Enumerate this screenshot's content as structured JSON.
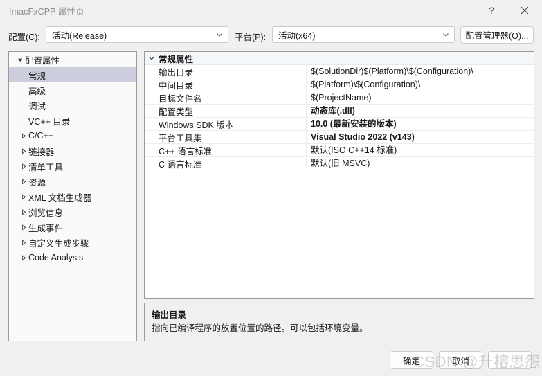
{
  "window": {
    "title": "ImacFxCPP 属性页",
    "help_icon": "question-mark-icon",
    "close_icon": "close-icon"
  },
  "config_bar": {
    "configuration_label": "配置(C):",
    "configuration_value": "活动(Release)",
    "platform_label": "平台(P):",
    "platform_value": "活动(x64)",
    "config_manager_label": "配置管理器(O)..."
  },
  "tree": {
    "items": [
      {
        "label": "配置属性",
        "level": 0,
        "twisty": "expanded",
        "selected": false
      },
      {
        "label": "常规",
        "level": 1,
        "twisty": "none",
        "selected": true
      },
      {
        "label": "高级",
        "level": 1,
        "twisty": "none",
        "selected": false
      },
      {
        "label": "调试",
        "level": 1,
        "twisty": "none",
        "selected": false
      },
      {
        "label": "VC++ 目录",
        "level": 1,
        "twisty": "none",
        "selected": false
      },
      {
        "label": "C/C++",
        "level": 1,
        "twisty": "collapsed",
        "selected": false
      },
      {
        "label": "链接器",
        "level": 1,
        "twisty": "collapsed",
        "selected": false
      },
      {
        "label": "清单工具",
        "level": 1,
        "twisty": "collapsed",
        "selected": false
      },
      {
        "label": "资源",
        "level": 1,
        "twisty": "collapsed",
        "selected": false
      },
      {
        "label": "XML 文档生成器",
        "level": 1,
        "twisty": "collapsed",
        "selected": false
      },
      {
        "label": "浏览信息",
        "level": 1,
        "twisty": "collapsed",
        "selected": false
      },
      {
        "label": "生成事件",
        "level": 1,
        "twisty": "collapsed",
        "selected": false
      },
      {
        "label": "自定义生成步骤",
        "level": 1,
        "twisty": "collapsed",
        "selected": false
      },
      {
        "label": "Code Analysis",
        "level": 1,
        "twisty": "collapsed",
        "selected": false
      }
    ]
  },
  "properties": {
    "group_header": "常规属性",
    "group_twisty": "chevron-down-icon",
    "rows": [
      {
        "name": "输出目录",
        "value": "$(SolutionDir)$(Platform)\\$(Configuration)\\",
        "bold": false
      },
      {
        "name": "中间目录",
        "value": "$(Platform)\\$(Configuration)\\",
        "bold": false
      },
      {
        "name": "目标文件名",
        "value": "$(ProjectName)",
        "bold": false
      },
      {
        "name": "配置类型",
        "value": "动态库(.dll)",
        "bold": true
      },
      {
        "name": "Windows SDK 版本",
        "value": "10.0 (最新安装的版本)",
        "bold": true
      },
      {
        "name": "平台工具集",
        "value": "Visual Studio 2022 (v143)",
        "bold": true
      },
      {
        "name": "C++ 语言标准",
        "value": "默认(ISO C++14 标准)",
        "bold": false
      },
      {
        "name": "C 语言标准",
        "value": "默认(旧 MSVC)",
        "bold": false
      }
    ]
  },
  "description": {
    "title": "输出目录",
    "body": "指向已编译程序的放置位置的路径。可以包括环境变量。"
  },
  "footer": {
    "ok_label": "确定",
    "cancel_label": "取消",
    "apply_label": ""
  },
  "watermark": {
    "text": "CSDN @升榕思怨"
  },
  "colors": {
    "selection": "#cdcedd",
    "group_header_bg": "#f4f7fa",
    "dialog_bg": "#f0f0f0",
    "panel_border": "#9a9a9a"
  }
}
